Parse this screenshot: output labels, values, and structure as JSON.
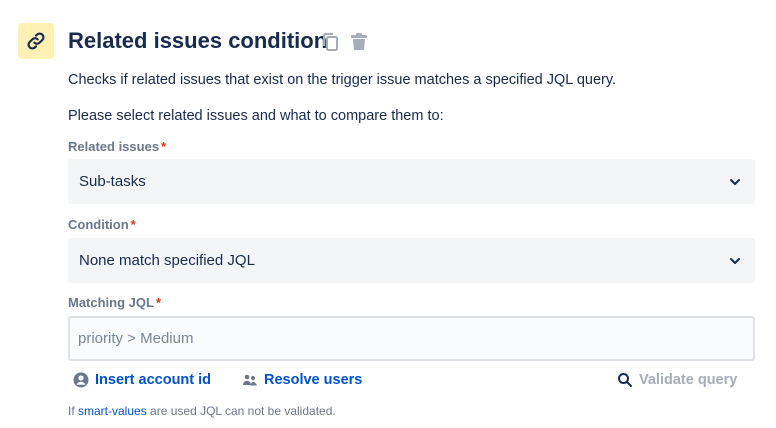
{
  "header": {
    "title": "Related issues condition",
    "badge_icon": "link-icon",
    "actions": [
      "copy-icon",
      "trash-icon"
    ]
  },
  "description": {
    "line1": "Checks if related issues that exist on the trigger issue matches a specified JQL query.",
    "line2": "Please select related issues and what to compare them to:"
  },
  "fields": {
    "related_issues": {
      "label": "Related issues",
      "required_mark": "*",
      "value": "Sub-tasks"
    },
    "condition": {
      "label": "Condition",
      "required_mark": "*",
      "value": "None match specified JQL"
    },
    "matching_jql": {
      "label": "Matching JQL",
      "required_mark": "*",
      "placeholder": "priority > Medium",
      "value": ""
    }
  },
  "actions": {
    "insert_account_id": "Insert account id",
    "resolve_users": "Resolve users",
    "validate_query": "Validate query"
  },
  "hint": {
    "prefix": "If ",
    "link": "smart-values",
    "suffix": " are used JQL can not be validated."
  },
  "colors": {
    "badge_bg": "#fff0b3",
    "link_blue": "#0052cc",
    "disabled": "#a5adba",
    "required": "#de350b"
  }
}
